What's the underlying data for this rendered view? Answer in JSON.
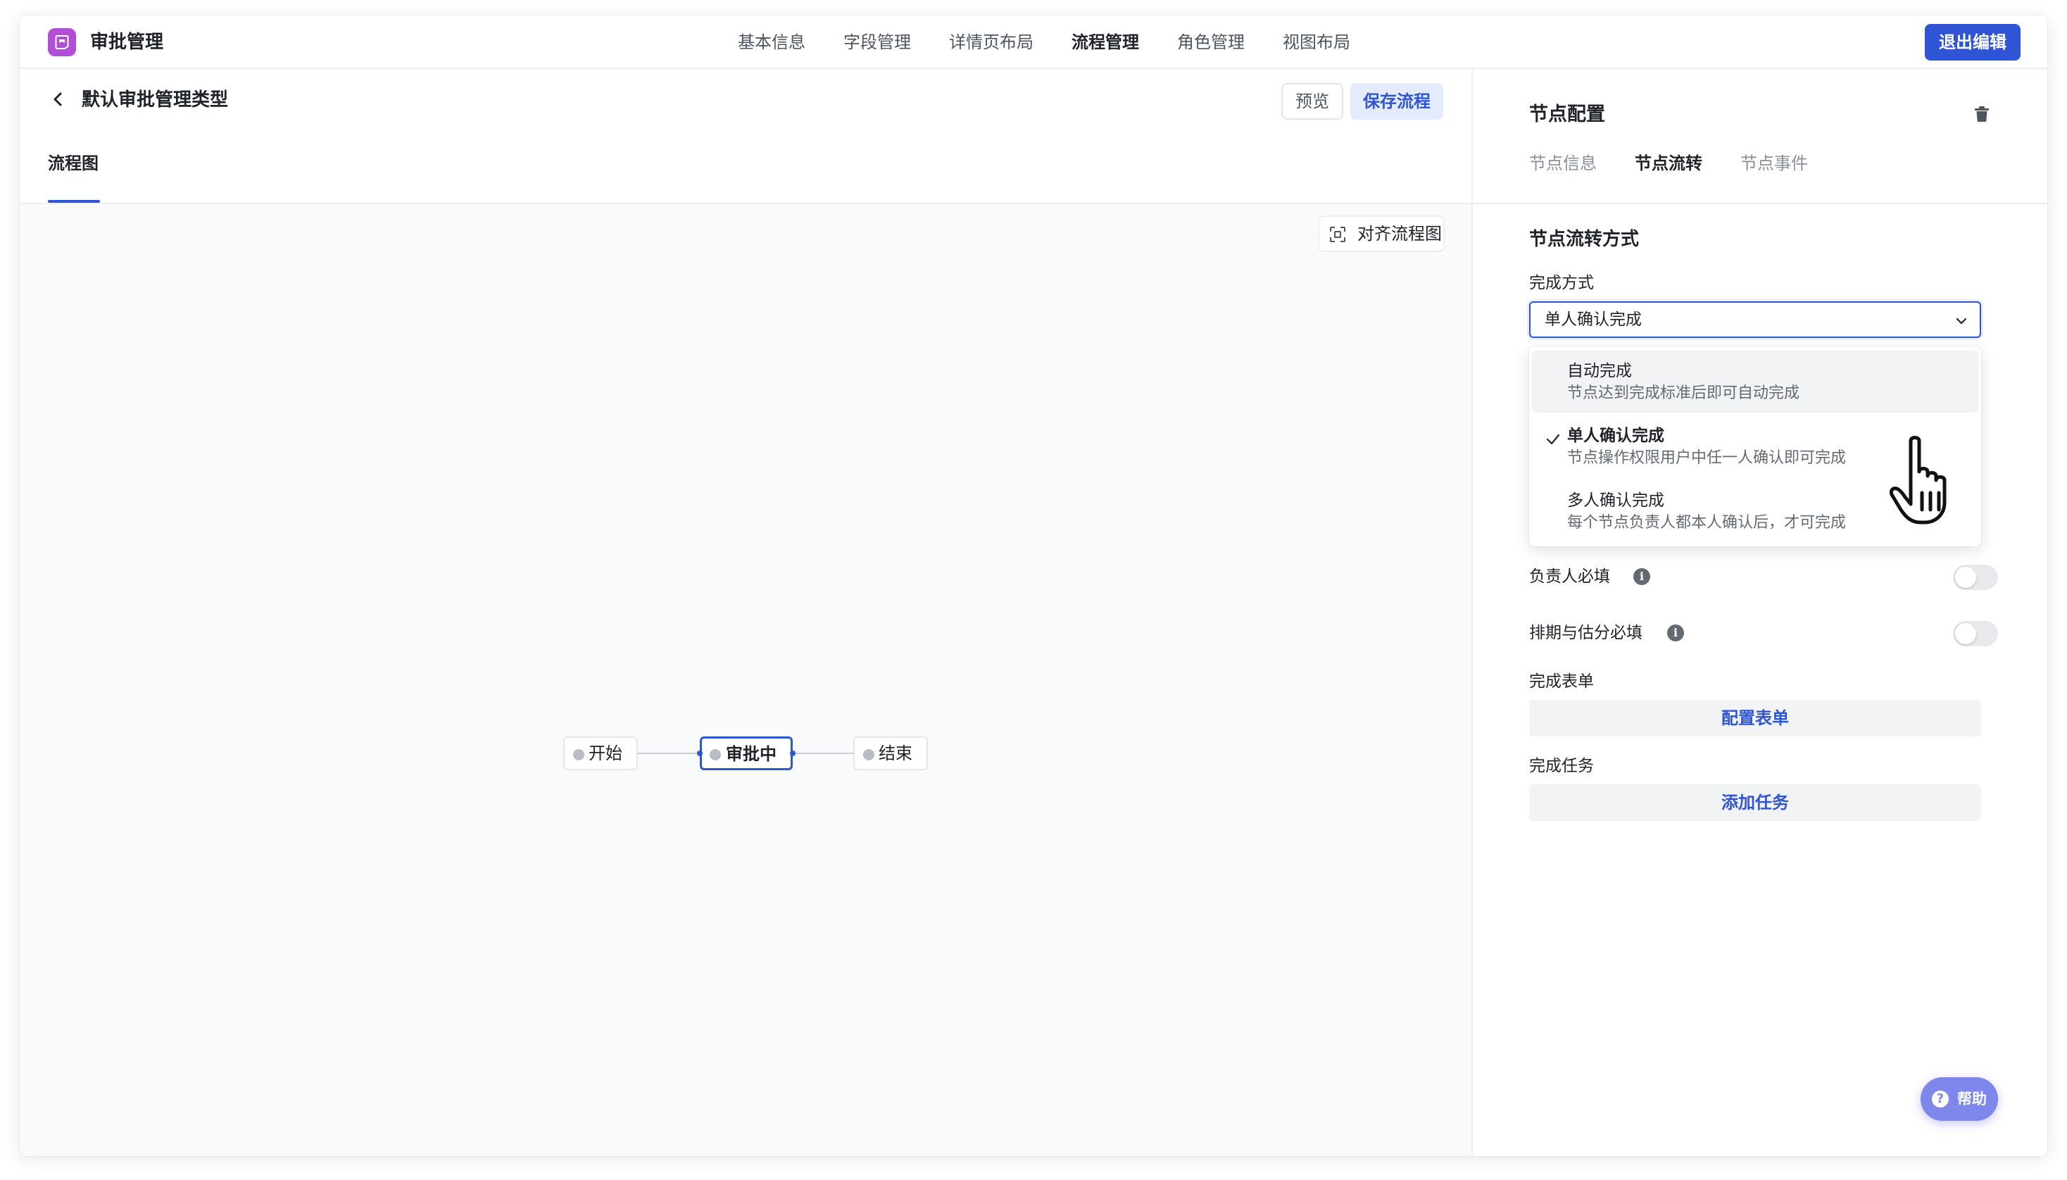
{
  "app": {
    "title": "审批管理",
    "icon": "approval-doc-icon",
    "brand_color": "#b04fd6",
    "accent_color": "#2f55d4"
  },
  "topnav": {
    "items": [
      {
        "label": "基本信息",
        "active": false
      },
      {
        "label": "字段管理",
        "active": false
      },
      {
        "label": "详情页布局",
        "active": false
      },
      {
        "label": "流程管理",
        "active": true
      },
      {
        "label": "角色管理",
        "active": false
      },
      {
        "label": "视图布局",
        "active": false
      }
    ],
    "exit_label": "退出编辑"
  },
  "workflow": {
    "title": "默认审批管理类型",
    "preview_label": "预览",
    "save_label": "保存流程",
    "tab_label": "流程图",
    "align_label": "对齐流程图",
    "nodes": [
      {
        "label": "开始",
        "active": false
      },
      {
        "label": "审批中",
        "active": true
      },
      {
        "label": "结束",
        "active": false
      }
    ]
  },
  "config": {
    "title": "节点配置",
    "tabs": [
      {
        "label": "节点信息",
        "active": false
      },
      {
        "label": "节点流转",
        "active": true
      },
      {
        "label": "节点事件",
        "active": false
      }
    ],
    "section_title": "节点流转方式",
    "completion_label": "完成方式",
    "completion_value": "单人确认完成",
    "options": [
      {
        "title": "自动完成",
        "desc": "节点达到完成标准后即可自动完成",
        "selected": false,
        "hovered": true
      },
      {
        "title": "单人确认完成",
        "desc": "节点操作权限用户中任一人确认即可完成",
        "selected": true,
        "hovered": false
      },
      {
        "title": "多人确认完成",
        "desc": "每个节点负责人都本人确认后，才可完成",
        "selected": false,
        "hovered": false
      }
    ],
    "owner_required_label": "负责人必填",
    "owner_required_on": false,
    "schedule_required_label": "排期与估分必填",
    "schedule_required_on": false,
    "form_label": "完成表单",
    "form_button": "配置表单",
    "task_label": "完成任务",
    "task_button": "添加任务"
  },
  "help": {
    "label": "帮助"
  }
}
